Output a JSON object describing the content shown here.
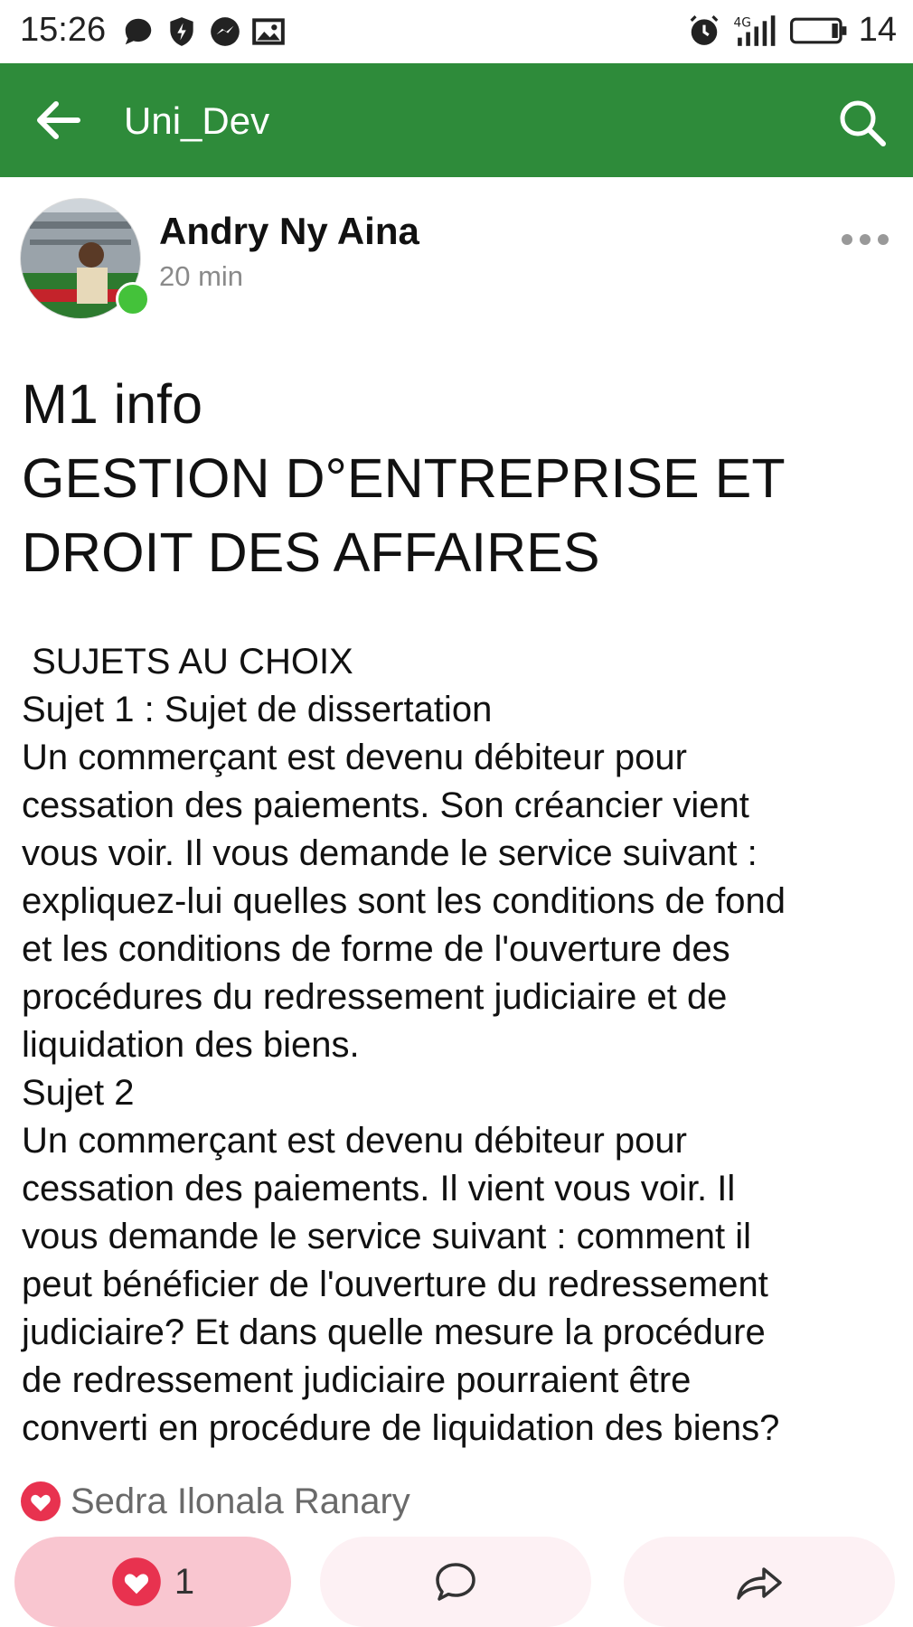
{
  "status_bar": {
    "time": "15:26",
    "battery_level": "14",
    "network_label": "4G",
    "icons_left": [
      "chat-bubble-icon",
      "shield-icon",
      "messenger-icon",
      "image-icon"
    ],
    "icons_right": [
      "alarm-icon",
      "signal-icon",
      "battery-icon"
    ]
  },
  "app_bar": {
    "title": "Uni_Dev",
    "color": "#2e8b3a"
  },
  "post": {
    "author": "Andry Ny Aina",
    "time": "20 min",
    "title_lines": [
      "M1 info",
      "GESTION D°ENTREPRISE ET",
      "DROIT DES AFFAIRES"
    ],
    "body_lines": [
      " SUJETS AU CHOIX",
      "Sujet 1 : Sujet de dissertation",
      "Un commerçant est devenu débiteur pour",
      "cessation des paiements. Son créancier vient",
      "vous voir. Il vous demande le service suivant :",
      "expliquez-lui quelles sont les conditions de fond",
      "et les conditions de forme de l'ouverture des",
      "procédures du redressement judiciaire et de",
      "liquidation des biens.",
      "Sujet 2",
      "Un commerçant est devenu débiteur pour",
      "cessation des paiements. Il vient vous voir. Il",
      "vous demande le service suivant : comment il",
      "peut bénéficier de l'ouverture du redressement",
      "judiciaire? Et dans quelle mesure la procédure",
      "de redressement judiciaire pourraient être",
      "converti en procédure de liquidation des biens?"
    ],
    "reaction_by": "Sedra Ilonala Ranary",
    "like_count": "1"
  },
  "colors": {
    "accent_green": "#2e8b3a",
    "like_red": "#e8324f",
    "online_green": "#44c23a"
  }
}
